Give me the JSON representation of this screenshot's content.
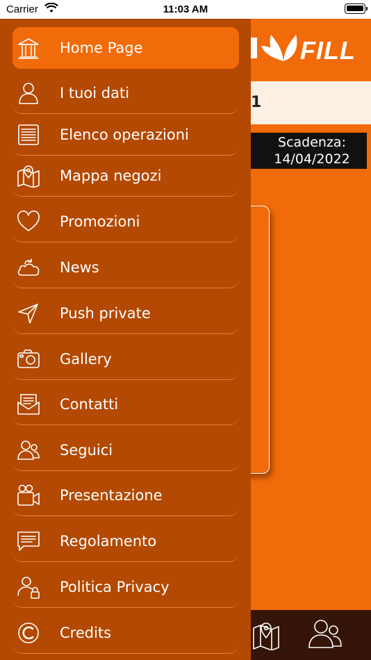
{
  "status_bar": {
    "carrier": "Carrier",
    "time": "11:03 AM"
  },
  "background": {
    "logo_text": "FILL",
    "card_digit": "1",
    "expiry_label": "Scadenza:",
    "expiry_date": "14/04/2022"
  },
  "menu": {
    "items": [
      {
        "label": "Home Page",
        "icon": "home-icon",
        "active": true
      },
      {
        "label": "I tuoi dati",
        "icon": "user-icon"
      },
      {
        "label": "Elenco operazioni",
        "icon": "list-icon"
      },
      {
        "label": "Mappa negozi",
        "icon": "map-icon"
      },
      {
        "label": "Promozioni",
        "icon": "heart-icon"
      },
      {
        "label": "News",
        "icon": "cloud-refresh-icon"
      },
      {
        "label": "Push private",
        "icon": "send-icon"
      },
      {
        "label": "Gallery",
        "icon": "camera-icon"
      },
      {
        "label": "Contatti",
        "icon": "mail-icon"
      },
      {
        "label": "Seguici",
        "icon": "users-icon"
      },
      {
        "label": "Presentazione",
        "icon": "video-camera-icon"
      },
      {
        "label": "Regolamento",
        "icon": "chat-lines-icon"
      },
      {
        "label": "Politica Privacy",
        "icon": "user-lock-icon"
      },
      {
        "label": "Credits",
        "icon": "copyright-icon"
      }
    ]
  },
  "colors": {
    "accent": "#F26B0A",
    "drawer": "#B34902",
    "divider": "#F07F37",
    "tabbar": "#351507"
  }
}
